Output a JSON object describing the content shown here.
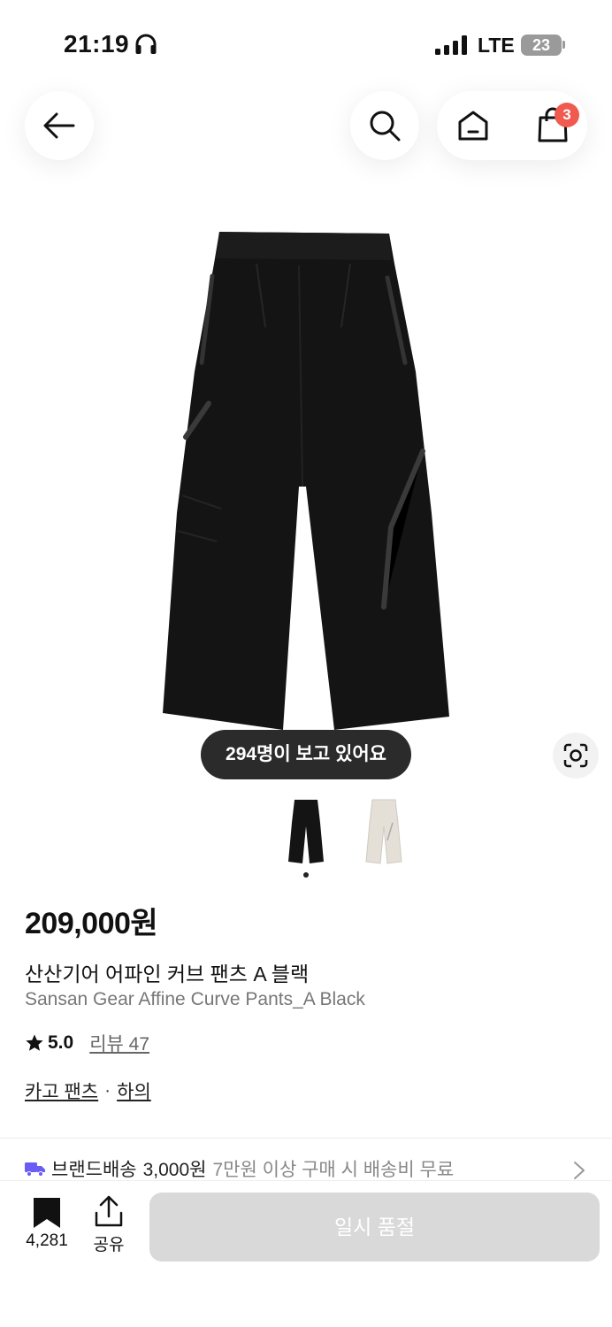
{
  "status_bar": {
    "time": "21:19",
    "network": "LTE",
    "battery": "23"
  },
  "nav": {
    "cart_count": "3",
    "icons": [
      "arrow-left-icon",
      "search-icon",
      "home-icon",
      "shopping-bag-icon"
    ]
  },
  "gallery": {
    "viewers_text": "294명이 보고 있어요",
    "thumbnails": [
      "black",
      "ivory"
    ],
    "selected_index": 0
  },
  "product": {
    "price": "209,000원",
    "name_ko": "산산기어 어파인 커브 팬츠 A 블랙",
    "name_en": "Sansan Gear Affine Curve Pants_A Black",
    "rating": "5.0",
    "review_label": "리뷰 47",
    "category": "카고 팬츠",
    "category_sep": "·",
    "parent_category": "하의"
  },
  "shipping": {
    "title": "브랜드배송",
    "fee": "3,000원",
    "note": "7만원 이상 구매 시 배송비 무료"
  },
  "bottom_bar": {
    "bookmark_count": "4,281",
    "share_label": "공유",
    "cta_label": "일시 품절"
  },
  "colors": {
    "badge": "#f05a4f",
    "cta_disabled": "#d9d9d9",
    "truck": "#6b5cf6"
  }
}
